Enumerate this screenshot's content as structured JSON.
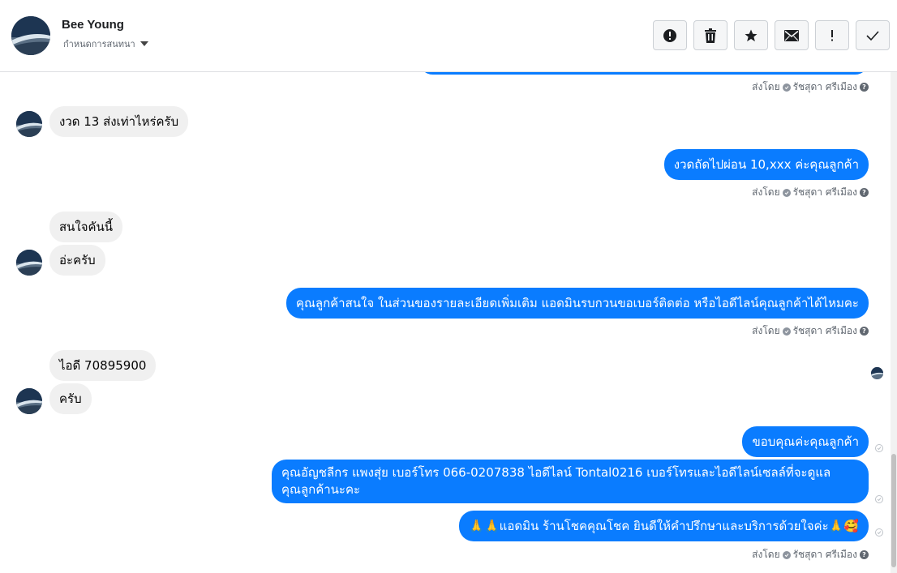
{
  "header": {
    "name": "Bee Young",
    "subtitle": "กำหนดการสนทนา"
  },
  "toolbar": {
    "buttons": [
      {
        "icon": "alert-circle-icon"
      },
      {
        "icon": "trash-icon"
      },
      {
        "icon": "star-icon"
      },
      {
        "icon": "envelope-icon"
      },
      {
        "icon": "exclamation-icon"
      },
      {
        "icon": "checkmark-icon"
      }
    ]
  },
  "sent_by": {
    "prefix": "ส่งโดย",
    "agent": "รัชสุดา ศรีเมือง",
    "help": "?"
  },
  "messages": {
    "m1": "งวด 13 ส่งเท่าไหร่ครับ",
    "m2": "งวดถัดไปผ่อน 10,xxx  ค่ะคุณลูกค้า",
    "m3": "สนใจคันนี้",
    "m4": "อ่ะครับ",
    "m5": "คุณลูกค้าสนใจ ในส่วนของรายละเอียดเพิ่มเติม แอดมินรบกวนขอเบอร์ติดต่อ หรือไอดีไลน์คุณลูกค้าได้ไหมคะ",
    "m6": "ไอดี 70895900",
    "m7": "ครับ",
    "m8": "ขอบคุณค่ะคุณลูกค้า",
    "m9a": "คุณอัญชลีกร แพงสุ่ย      เบอร์โทร 066-0207838 ไอดีไลน์ Tontal0216   เบอร์โทรและไอดีไลน์เซลล์ที่จะดูแล",
    "m9b": "คุณลูกค้านะคะ",
    "m10": "🙏🙏แอดมิน ร้านโชคคุณโชค ยินดีให้คำปรึกษาและบริการด้วยใจค่ะ🙏🥰"
  },
  "colors": {
    "outgoing": "#0a7cff",
    "incoming": "#f0f0f0"
  }
}
